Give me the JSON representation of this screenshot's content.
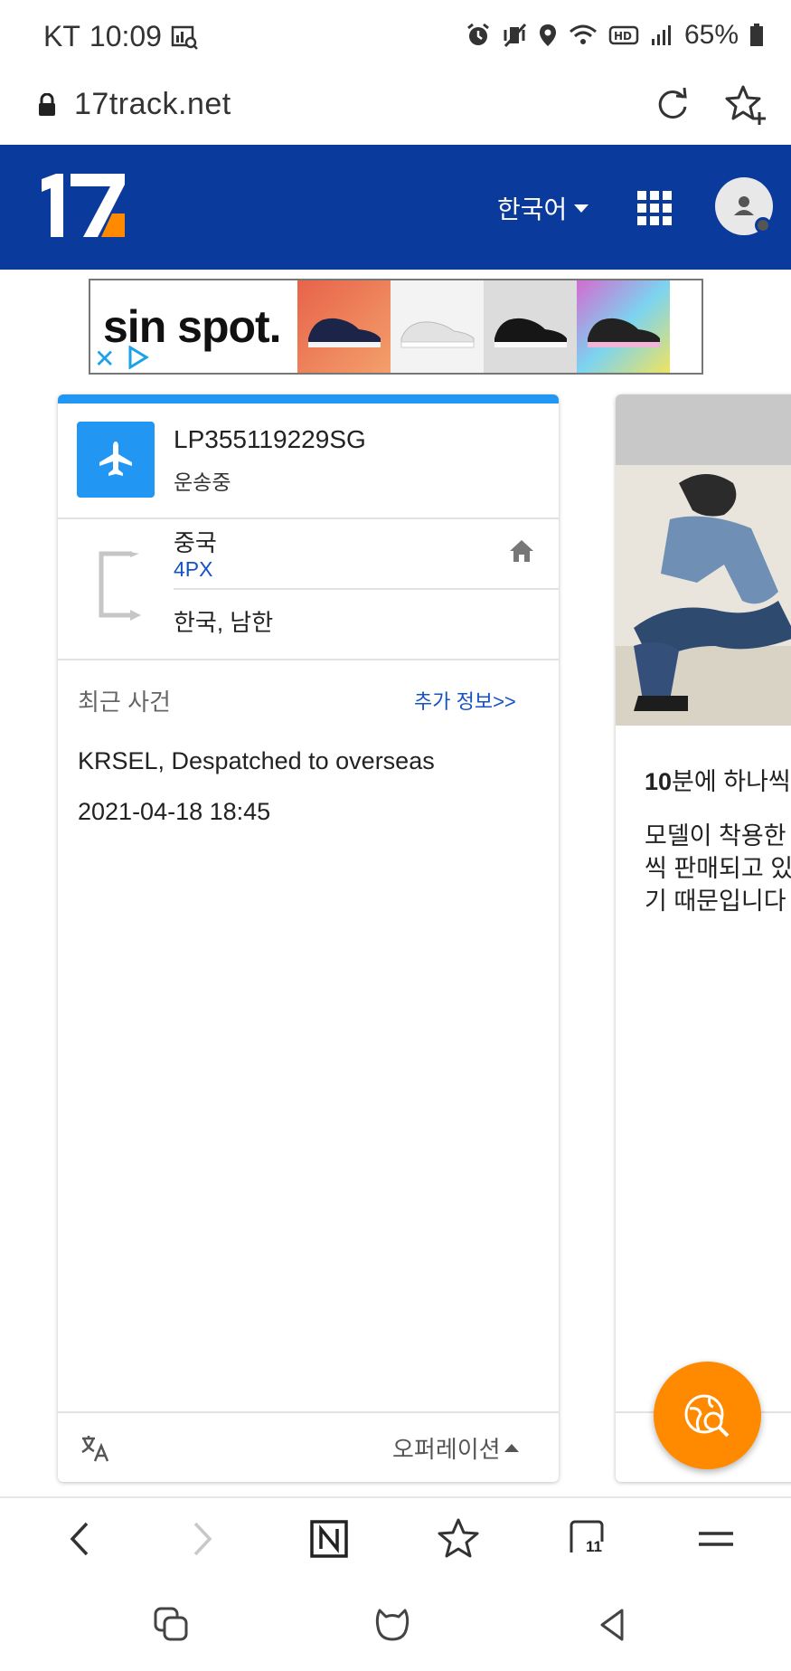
{
  "status_bar": {
    "carrier": "KT",
    "time": "10:09",
    "battery": "65%",
    "icons": [
      "gallery-stats-icon",
      "alarm-icon",
      "vibrate-mute-icon",
      "location-icon",
      "wifi-6-icon",
      "hd-voice-icon",
      "signal-icon",
      "battery-icon"
    ]
  },
  "browser": {
    "url": "17track.net",
    "tab_count": "11"
  },
  "header": {
    "logo_text": "17",
    "language": "한국어",
    "brand_color": "#0a3a9c"
  },
  "ad": {
    "brand": "sin spot."
  },
  "tracking_card": {
    "tracking_number": "LP355119229SG",
    "status": "운송중",
    "origin": "중국",
    "carrier": "4PX",
    "destination": "한국, 남한",
    "events_heading": "최근 사건",
    "more_info": "추가 정보>>",
    "latest_event": {
      "description": "KRSEL, Despatched to overseas",
      "time": "2021-04-18 18:45"
    },
    "operations_label": "오퍼레이션",
    "accent_color": "#2196f3"
  },
  "promo_card": {
    "title_bold": "10",
    "title_rest": "분에 하나씩",
    "body": "모델이 착용한\n씩 판매되고 있\n기 때문입니다"
  },
  "fab": {
    "icon": "globe-search-icon",
    "color": "#ff8a00"
  }
}
